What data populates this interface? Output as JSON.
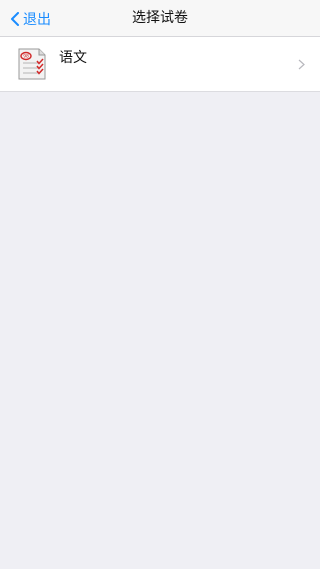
{
  "navbar": {
    "back_label": "退出",
    "title": "选择试卷"
  },
  "list": {
    "items": [
      {
        "label": "语文",
        "icon": "exam-paper-icon"
      }
    ]
  },
  "colors": {
    "accent": "#1a8cff",
    "background": "#efeff4",
    "navbar": "#f7f7f7"
  }
}
